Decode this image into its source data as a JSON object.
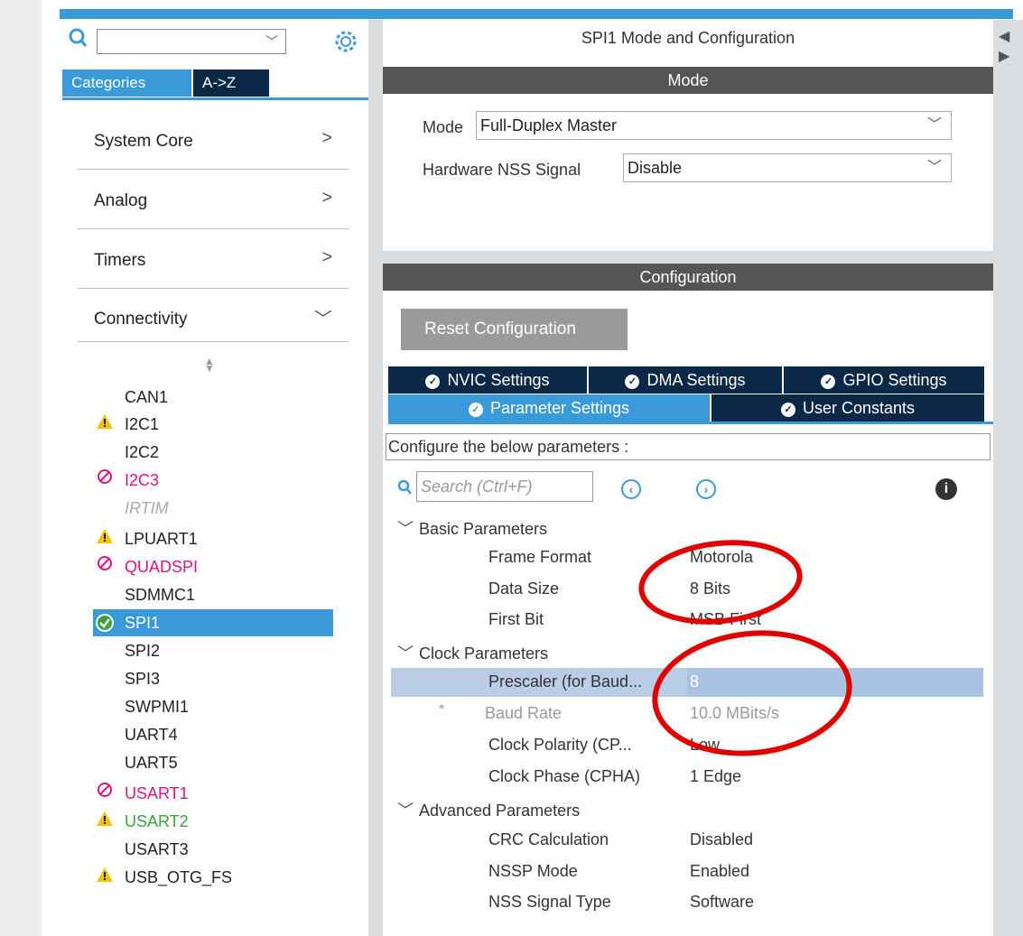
{
  "left": {
    "tabs": {
      "categories": "Categories",
      "az": "A->Z"
    },
    "categories": [
      {
        "label": "System Core",
        "arrow": ">"
      },
      {
        "label": "Analog",
        "arrow": ">"
      },
      {
        "label": "Timers",
        "arrow": ">"
      },
      {
        "label": "Connectivity",
        "arrow": "v"
      }
    ],
    "peripherals": [
      {
        "label": "CAN1",
        "status": "none"
      },
      {
        "label": "I2C1",
        "status": "warning"
      },
      {
        "label": "I2C2",
        "status": "none"
      },
      {
        "label": "I2C3",
        "status": "disabled"
      },
      {
        "label": "IRTIM",
        "status": "unavailable"
      },
      {
        "label": "LPUART1",
        "status": "warning"
      },
      {
        "label": "QUADSPI",
        "status": "disabled"
      },
      {
        "label": "SDMMC1",
        "status": "none"
      },
      {
        "label": "SPI1",
        "status": "selected"
      },
      {
        "label": "SPI2",
        "status": "none"
      },
      {
        "label": "SPI3",
        "status": "none"
      },
      {
        "label": "SWPMI1",
        "status": "none"
      },
      {
        "label": "UART4",
        "status": "none"
      },
      {
        "label": "UART5",
        "status": "none"
      },
      {
        "label": "USART1",
        "status": "disabled"
      },
      {
        "label": "USART2",
        "status": "warning-green"
      },
      {
        "label": "USART3",
        "status": "none"
      },
      {
        "label": "USB_OTG_FS",
        "status": "warning"
      }
    ]
  },
  "right": {
    "title": "SPI1 Mode and Configuration",
    "mode_bar": "Mode",
    "mode": {
      "label": "Mode",
      "value": "Full-Duplex Master"
    },
    "nss": {
      "label": "Hardware NSS Signal",
      "value": "Disable"
    },
    "config_bar": "Configuration",
    "reset_button": "Reset Configuration",
    "tabs_row1": [
      "NVIC Settings",
      "DMA Settings",
      "GPIO Settings"
    ],
    "tabs_row2": [
      "Parameter Settings",
      "User Constants"
    ],
    "configure_label": "Configure the below parameters :",
    "search_placeholder": "Search (Ctrl+F)",
    "groups": {
      "basic": "Basic Parameters",
      "clock": "Clock Parameters",
      "advanced": "Advanced Parameters"
    },
    "params": {
      "frame_format": {
        "label": "Frame Format",
        "value": "Motorola"
      },
      "data_size": {
        "label": "Data Size",
        "value": "8 Bits"
      },
      "first_bit": {
        "label": "First Bit",
        "value": "MSB First"
      },
      "prescaler": {
        "label": "Prescaler (for Baud...",
        "value": "8"
      },
      "baud_rate": {
        "marker": "*",
        "label": "Baud Rate",
        "value": "10.0 MBits/s"
      },
      "clock_polarity": {
        "label": "Clock Polarity (CP...",
        "value": "Low"
      },
      "clock_phase": {
        "label": "Clock Phase (CPHA)",
        "value": "1 Edge"
      },
      "crc": {
        "label": "CRC Calculation",
        "value": "Disabled"
      },
      "nssp": {
        "label": "NSSP Mode",
        "value": "Enabled"
      },
      "nss_type": {
        "label": "NSS Signal Type",
        "value": "Software"
      }
    }
  },
  "colors": {
    "accent": "#3a9ad9",
    "navy": "#0b2846",
    "annotation": "#e00000"
  }
}
